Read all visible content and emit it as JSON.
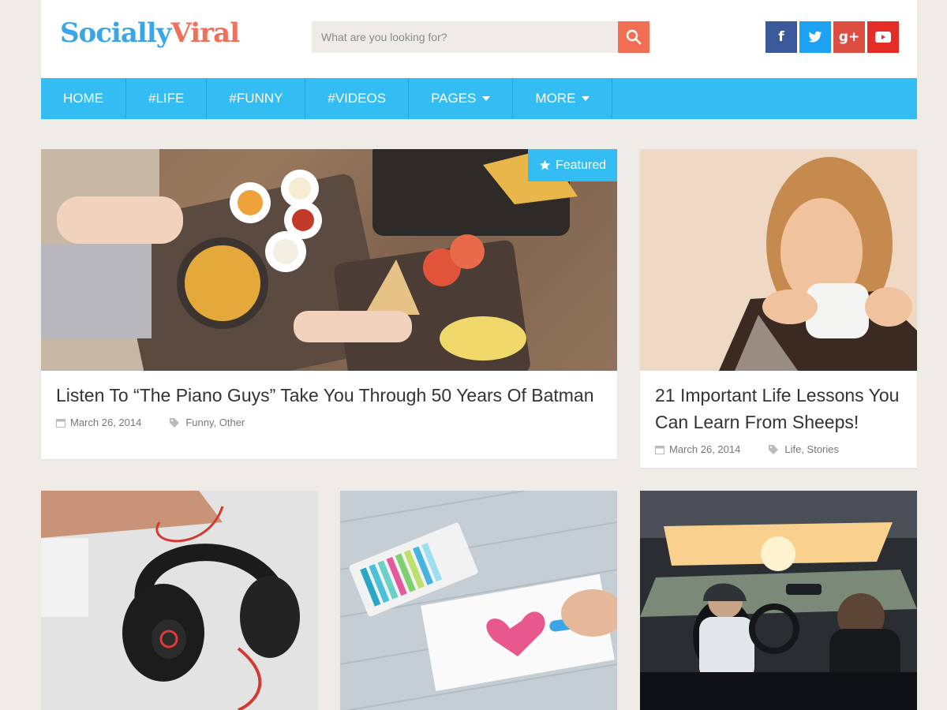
{
  "header": {
    "logo_part1": "Socially",
    "logo_part2": "Viral",
    "search_placeholder": "What are you looking for?",
    "social": [
      {
        "icon": "facebook-icon",
        "glyph": "f"
      },
      {
        "icon": "twitter-icon",
        "glyph": "t"
      },
      {
        "icon": "google-plus-icon",
        "glyph": "g+"
      },
      {
        "icon": "youtube-icon",
        "glyph": "▶"
      }
    ]
  },
  "nav": {
    "items": [
      {
        "label": "HOME"
      },
      {
        "label": "#LIFE"
      },
      {
        "label": "#FUNNY"
      },
      {
        "label": "#VIDEOS"
      },
      {
        "label": "PAGES",
        "dropdown": true
      },
      {
        "label": "MORE",
        "dropdown": true
      }
    ]
  },
  "posts": {
    "featured": {
      "badge": "Featured",
      "title": "Listen To “The Piano Guys” Take You Through 50 Years Of Batman",
      "date": "March 26, 2014",
      "tag1": "Funny",
      "tag2": "Other"
    },
    "second": {
      "title": "21 Important Life Lessons You Can Learn From Sheeps!",
      "date": "March 26, 2014",
      "tag1": "Life",
      "tag2": "Stories"
    }
  },
  "colors": {
    "accent": "#33bdf2",
    "search_button": "#f26f53",
    "background": "#efece8"
  }
}
